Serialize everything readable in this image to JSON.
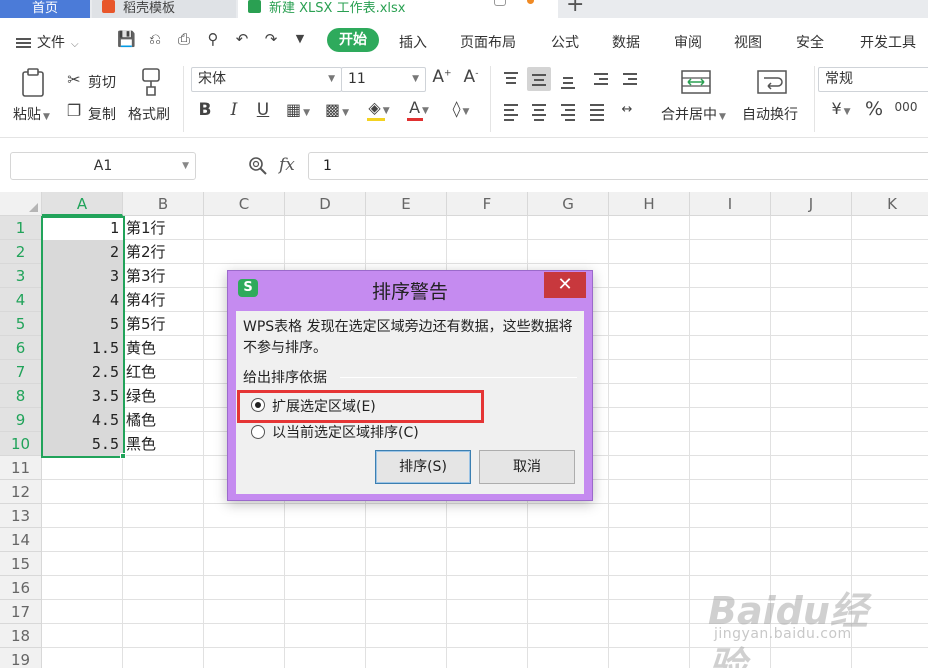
{
  "tabs": [
    {
      "label": "首页"
    },
    {
      "label": "稻壳模板"
    },
    {
      "label": "新建 XLSX 工作表.xlsx"
    }
  ],
  "menu": {
    "file_label": "文件",
    "items": [
      "开始",
      "插入",
      "页面布局",
      "公式",
      "数据",
      "审阅",
      "视图",
      "安全",
      "开发工具"
    ]
  },
  "ribbon": {
    "paste": "粘贴",
    "cut": "剪切",
    "copy": "复制",
    "format_painter": "格式刷",
    "font_name": "宋体",
    "font_size": "11",
    "merge_center": "合并居中",
    "wrap_text": "自动换行",
    "number_format": "常规"
  },
  "formula_bar": {
    "name_box": "A1",
    "fx": "fx",
    "value": "1"
  },
  "sheet": {
    "columns": [
      "A",
      "B",
      "C",
      "D",
      "E",
      "F",
      "G",
      "H",
      "I",
      "J",
      "K"
    ],
    "rows": [
      "1",
      "2",
      "3",
      "4",
      "5",
      "6",
      "7",
      "8",
      "9",
      "10",
      "11",
      "12",
      "13",
      "14",
      "15",
      "16",
      "17",
      "18",
      "19"
    ],
    "col_a": [
      "1",
      "2",
      "3",
      "4",
      "5",
      "1.5",
      "2.5",
      "3.5",
      "4.5",
      "5.5"
    ],
    "col_b": [
      "第1行",
      "第2行",
      "第3行",
      "第4行",
      "第5行",
      "黄色",
      "红色",
      "绿色",
      "橘色",
      "黑色"
    ]
  },
  "dialog": {
    "app_icon": "S",
    "title": "排序警告",
    "close": "✕",
    "message": "WPS表格 发现在选定区域旁边还有数据，这些数据将不参与排序。",
    "group_label": "给出排序依据",
    "options": [
      {
        "label": "扩展选定区域(E)",
        "checked": true
      },
      {
        "label": "以当前选定区域排序(C)",
        "checked": false
      }
    ],
    "sort_button": "排序(S)",
    "cancel_button": "取消"
  },
  "watermark": {
    "logo": "Baidu经验",
    "url": "jingyan.baidu.com"
  },
  "colors": {
    "accent_green": "#21a35a",
    "start_tab": "#2eaa5c",
    "dialog_frame": "#c58bf0",
    "highlight_red": "#e53535"
  }
}
